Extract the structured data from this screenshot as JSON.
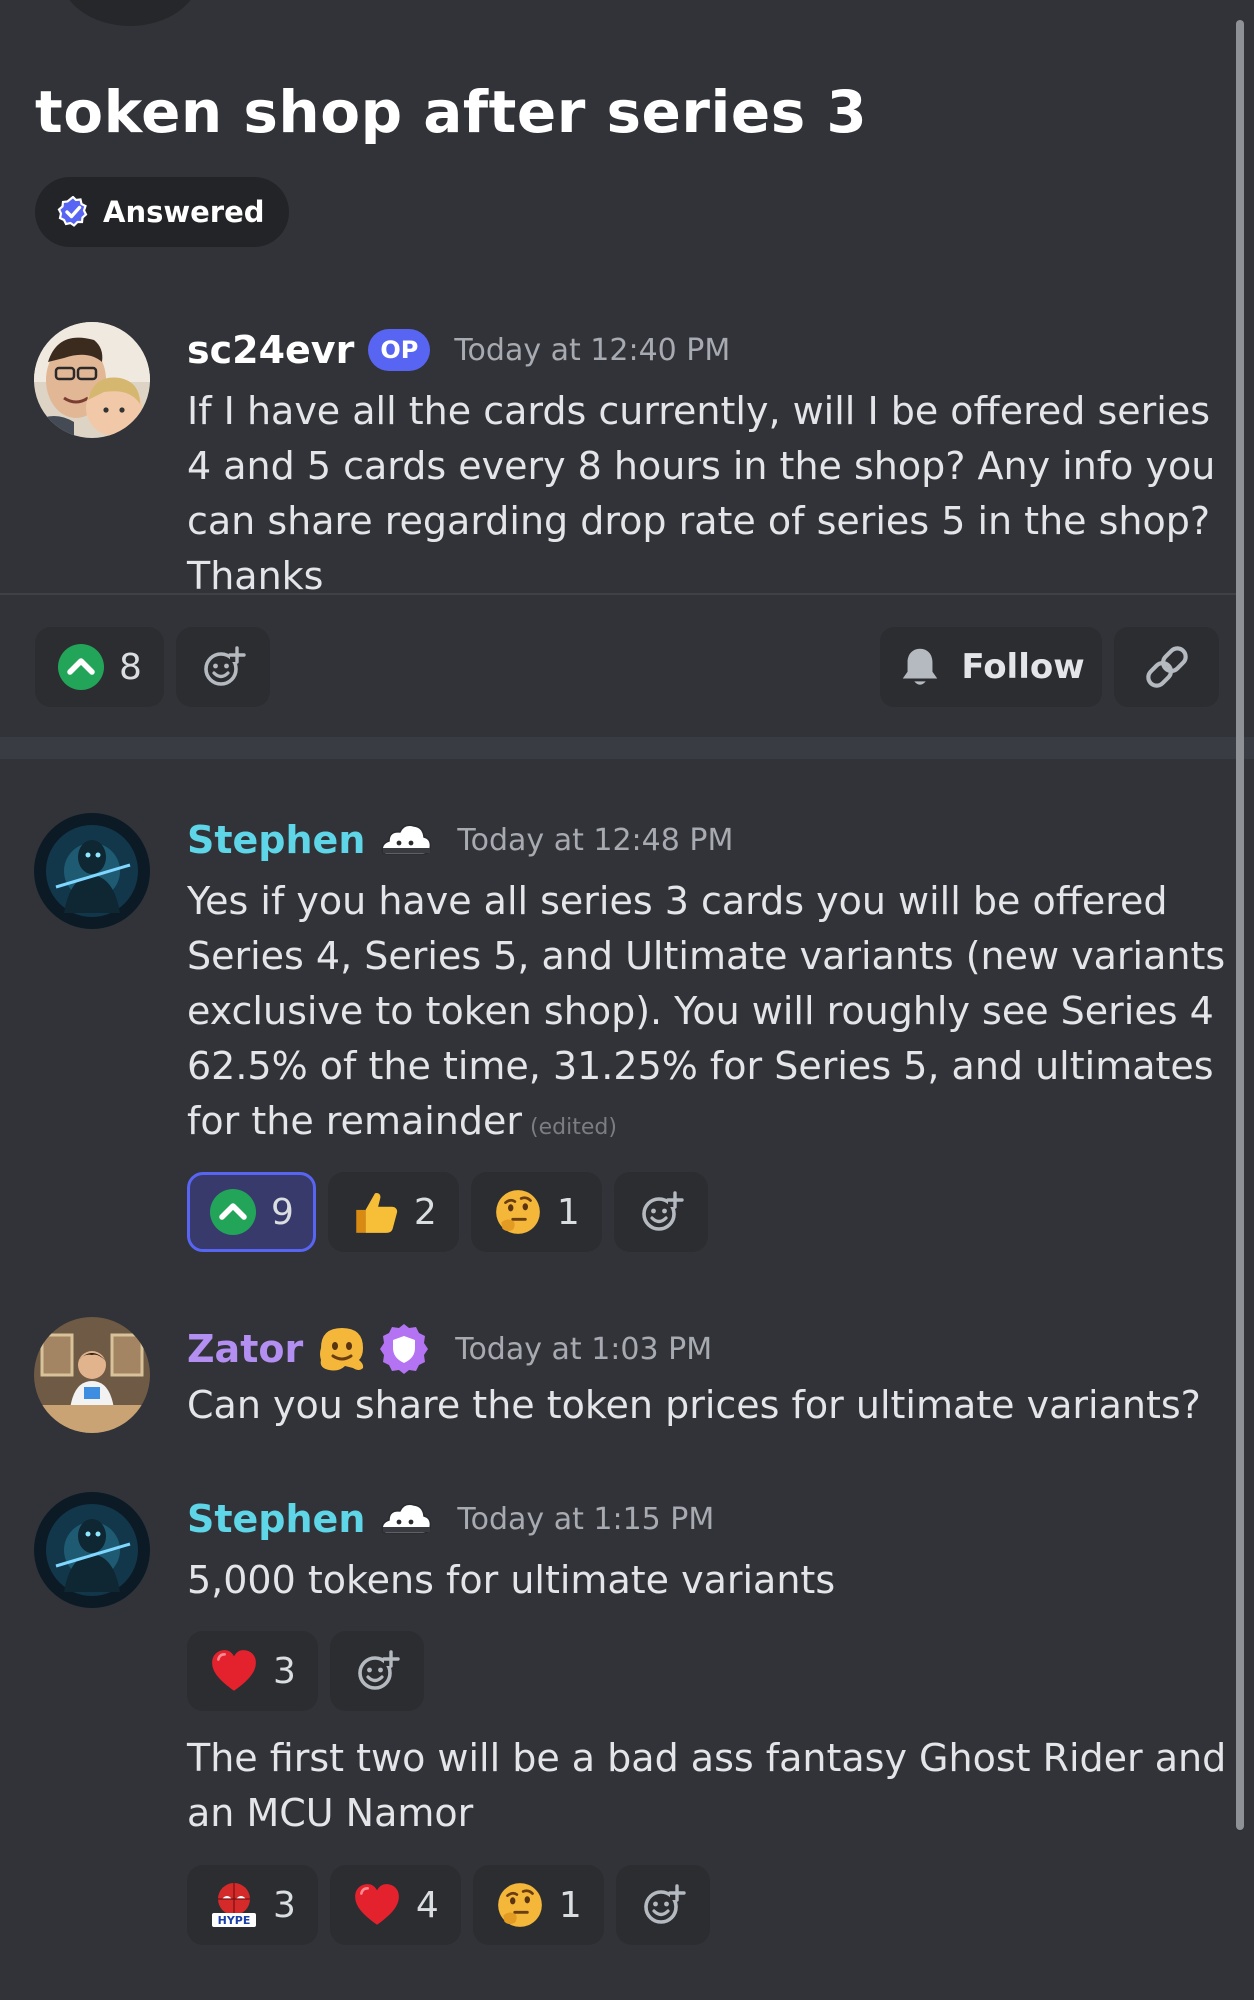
{
  "thread": {
    "title": "token shop after series 3",
    "status_label": "Answered"
  },
  "post": {
    "author": "sc24evr",
    "op_badge": "OP",
    "timestamp": "Today at 12:40 PM",
    "text": "If I have all the cards currently, will I be offered series 4 and 5 cards every 8 hours in the shop? Any info you can share regarding drop rate of series 5 in the shop? Thanks",
    "reactions": [
      {
        "icon": "upvote-icon",
        "count": "8"
      }
    ],
    "follow_label": "Follow"
  },
  "replies": [
    {
      "author": "Stephen",
      "author_color": "#5ed6e8",
      "timestamp": "Today at 12:48 PM",
      "text": "Yes if you have all series 3 cards you will be offered Series 4, Series 5, and Ultimate variants (new variants exclusive to token shop).  You will roughly see Series 4 62.5% of the time, 31.25% for Series 5, and ultimates for the remainder",
      "edited_label": "(edited)",
      "reactions": [
        {
          "icon": "upvote-icon",
          "count": "9"
        },
        {
          "icon": "thumbs-up-icon",
          "count": "2"
        },
        {
          "icon": "thinking-face-icon",
          "count": "1"
        }
      ]
    },
    {
      "author": "Zator",
      "author_color": "#b48ff2",
      "timestamp": "Today at 1:03 PM",
      "text": "Can you share the token prices for ultimate variants?"
    },
    {
      "author": "Stephen",
      "author_color": "#5ed6e8",
      "timestamp": "Today at 1:15 PM",
      "text": "5,000 tokens for ultimate variants",
      "reactions": [
        {
          "icon": "heart-icon",
          "count": "3"
        }
      ],
      "followup_text": "The first two will be a bad ass fantasy Ghost Rider and an MCU Namor",
      "followup_reactions": [
        {
          "icon": "hype-emoji-icon",
          "count": "3"
        },
        {
          "icon": "heart-icon",
          "count": "4"
        },
        {
          "icon": "thinking-face-icon",
          "count": "1"
        }
      ]
    }
  ],
  "colors": {
    "background": "#313338",
    "accent": "#5865f2",
    "upvote": "#23a559",
    "stephen": "#5ed6e8",
    "zator": "#b48ff2"
  }
}
